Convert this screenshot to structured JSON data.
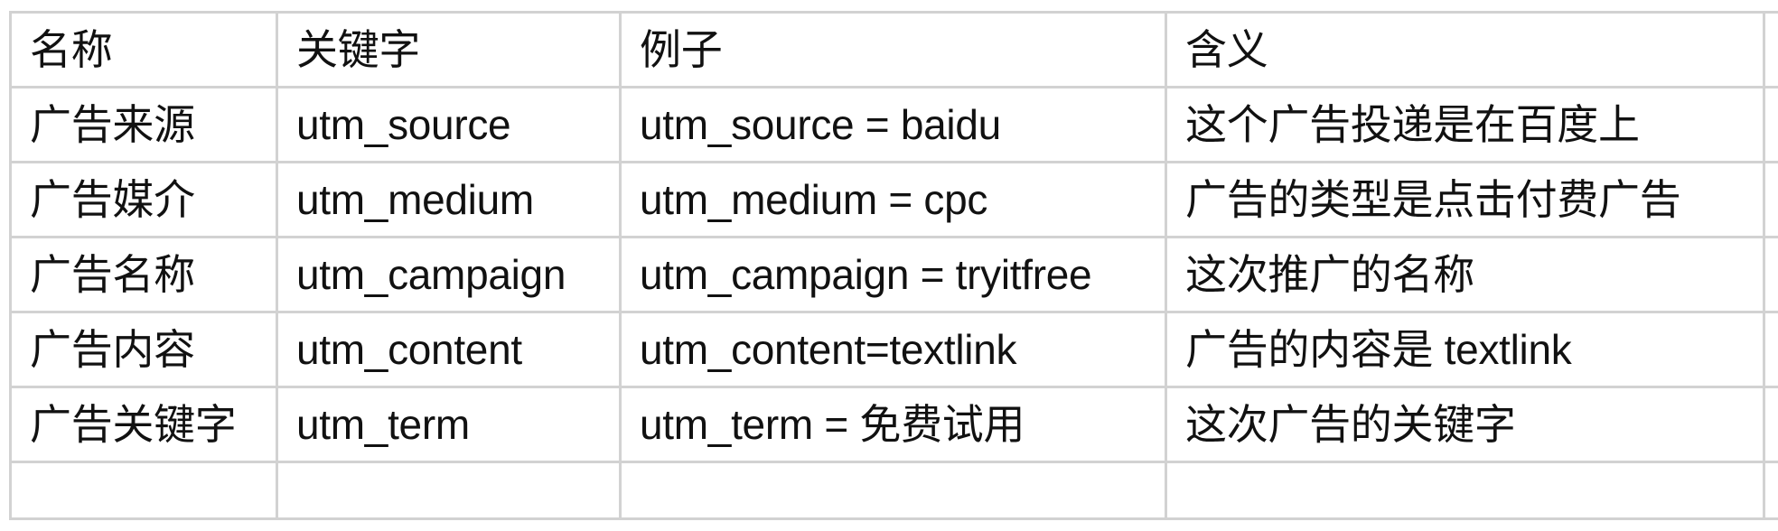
{
  "table": {
    "headers": [
      "名称",
      "关键字",
      "例子",
      "含义"
    ],
    "rows": [
      [
        "广告来源",
        "utm_source",
        "utm_source = baidu",
        "这个广告投递是在百度上"
      ],
      [
        "广告媒介",
        "utm_medium",
        "utm_medium = cpc",
        "广告的类型是点击付费广告"
      ],
      [
        "广告名称",
        "utm_campaign",
        "utm_campaign = tryitfree",
        "这次推广的名称"
      ],
      [
        "广告内容",
        "utm_content",
        "utm_content=textlink",
        "广告的内容是 textlink"
      ],
      [
        "广告关键字",
        "utm_term",
        "utm_term = 免费试用",
        "这次广告的关键字"
      ]
    ]
  },
  "colors": {
    "grid": "#d2d2d2",
    "text": "#111111",
    "background": "#ffffff"
  }
}
